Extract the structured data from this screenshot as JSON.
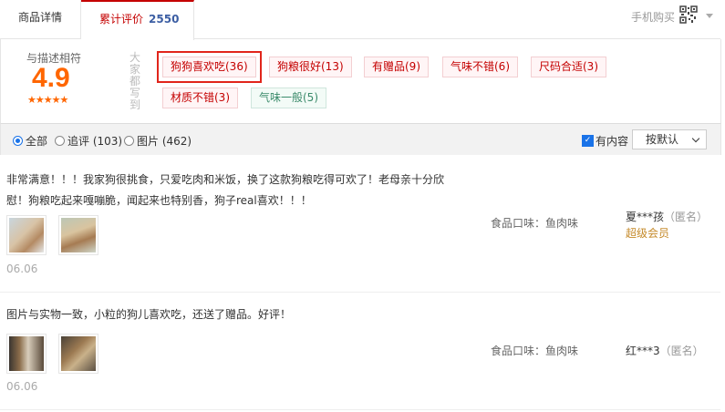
{
  "tabs": {
    "detail": "商品详情",
    "reviews": "累计评价",
    "review_count": "2550",
    "mobile": "手机购买"
  },
  "summary": {
    "label": "与描述相符",
    "score": "4.9",
    "stars": "★★★★★",
    "vertical_label": "大家都写到",
    "tags": [
      {
        "text": "狗狗喜欢吃(36)",
        "type": "positive"
      },
      {
        "text": "狗粮很好(13)",
        "type": "positive"
      },
      {
        "text": "有赠品(9)",
        "type": "positive"
      },
      {
        "text": "气味不错(6)",
        "type": "positive"
      },
      {
        "text": "尺码合适(3)",
        "type": "positive"
      },
      {
        "text": "材质不错(3)",
        "type": "positive"
      },
      {
        "text": "气味一般(5)",
        "type": "neutral"
      }
    ]
  },
  "filter": {
    "all": "全部",
    "followup": "追评 (103)",
    "pictures": "图片 (462)",
    "has_content": "有内容",
    "sort": "按默认"
  },
  "reviews": [
    {
      "text": "非常满意！！！我家狗很挑食，只爱吃肉和米饭，换了这款狗粮吃得可欢了！老母亲十分欣慰！狗粮吃起来嘎嘣脆，闻起来也特别香，狗子real喜欢！！！",
      "date": "06.06",
      "spec": "食品口味：鱼肉味",
      "user": "夏***孩",
      "anon": "（匿名）",
      "level": "超级会员"
    },
    {
      "text": "图片与实物一致，小粒的狗儿喜欢吃，还送了赠品。好评！",
      "date": "06.06",
      "spec": "食品口味：鱼肉味",
      "user": "红***3",
      "anon": "（匿名）",
      "level": ""
    }
  ]
}
